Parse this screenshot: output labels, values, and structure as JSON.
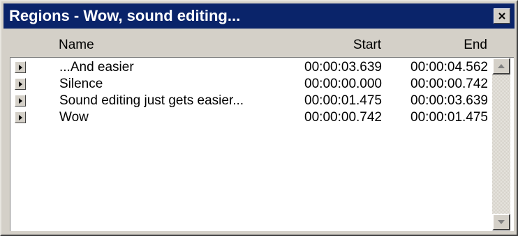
{
  "window": {
    "title": "Regions - Wow, sound editing...",
    "close_icon": "close-icon"
  },
  "columns": {
    "name": "Name",
    "start": "Start",
    "end": "End"
  },
  "rows": [
    {
      "name": "...And easier",
      "start": "00:00:03.639",
      "end": "00:00:04.562"
    },
    {
      "name": "Silence",
      "start": "00:00:00.000",
      "end": "00:00:00.742"
    },
    {
      "name": "Sound editing just gets easier...",
      "start": "00:00:01.475",
      "end": "00:00:03.639"
    },
    {
      "name": "Wow",
      "start": "00:00:00.742",
      "end": "00:00:01.475"
    }
  ],
  "colors": {
    "titlebar": "#0a246a",
    "window_face": "#d4d0c8",
    "list_background": "#ffffff"
  },
  "icons": {
    "row_icon": "play-icon",
    "scroll_up": "scroll-up-arrow-icon",
    "scroll_down": "scroll-down-arrow-icon"
  }
}
